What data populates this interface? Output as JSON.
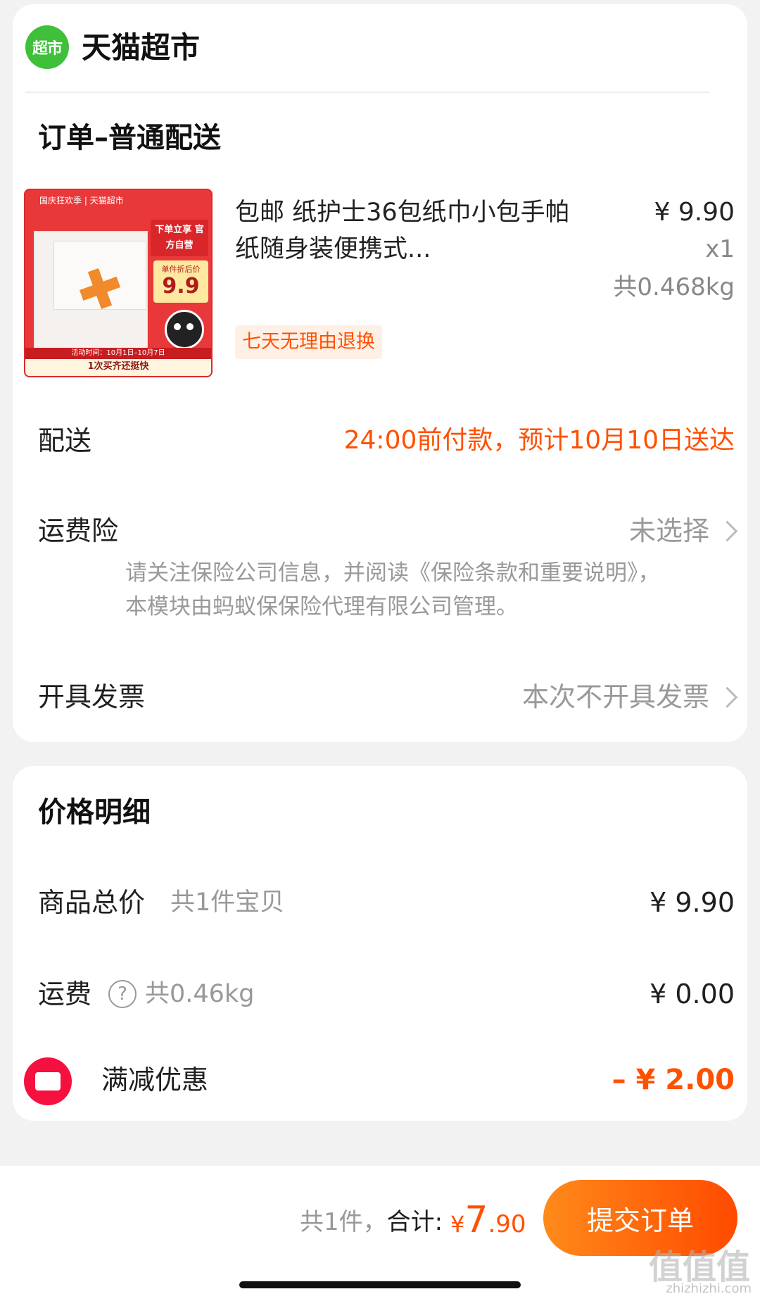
{
  "store": {
    "logo_text": "超市",
    "name": "天猫超市"
  },
  "order": {
    "section_title": "订单–普通配送",
    "product": {
      "image": {
        "top_text": "国庆狂欢季 | 天猫超市",
        "tag_text": "下单立享 官方自营",
        "price_caption": "单件折后价",
        "price_value": "9.9",
        "bottom_line1": "活动时间：10月1日–10月7日",
        "bottom_line2": "1次买齐还挺快"
      },
      "title": "包邮 纸护士36包纸巾小包手帕纸随身装便携式...",
      "price": "¥ 9.90",
      "quantity": "x1",
      "weight": "共0.468kg",
      "badge": "七天无理由退换"
    },
    "delivery": {
      "label": "配送",
      "value": "24:00前付款，预计10月10日送达"
    },
    "insurance": {
      "label": "运费险",
      "value": "未选择",
      "note": "请关注保险公司信息，并阅读《保险条款和重要说明》，本模块由蚂蚁保保险代理有限公司管理。"
    },
    "invoice": {
      "label": "开具发票",
      "value": "本次不开具发票"
    }
  },
  "price_detail": {
    "title": "价格明细",
    "goods_total": {
      "label": "商品总价",
      "sub": "共1件宝贝",
      "amount": "¥ 9.90"
    },
    "shipping": {
      "label": "运费",
      "help": "?",
      "sub": "共0.46kg",
      "amount": "¥ 0.00"
    },
    "discount": {
      "label": "满减优惠",
      "amount": "– ¥ 2.00"
    }
  },
  "footer": {
    "count_text": "共1件，",
    "total_label": "合计:",
    "currency": "¥",
    "total_int": "7",
    "total_dec": ".90",
    "submit_label": "提交订单"
  },
  "watermark": {
    "text": "值值值",
    "sub": "zhizhizhi.com"
  },
  "colors": {
    "accent": "#ff5000",
    "brand_green": "#3fbf3a",
    "discount_red": "#f5103f"
  }
}
